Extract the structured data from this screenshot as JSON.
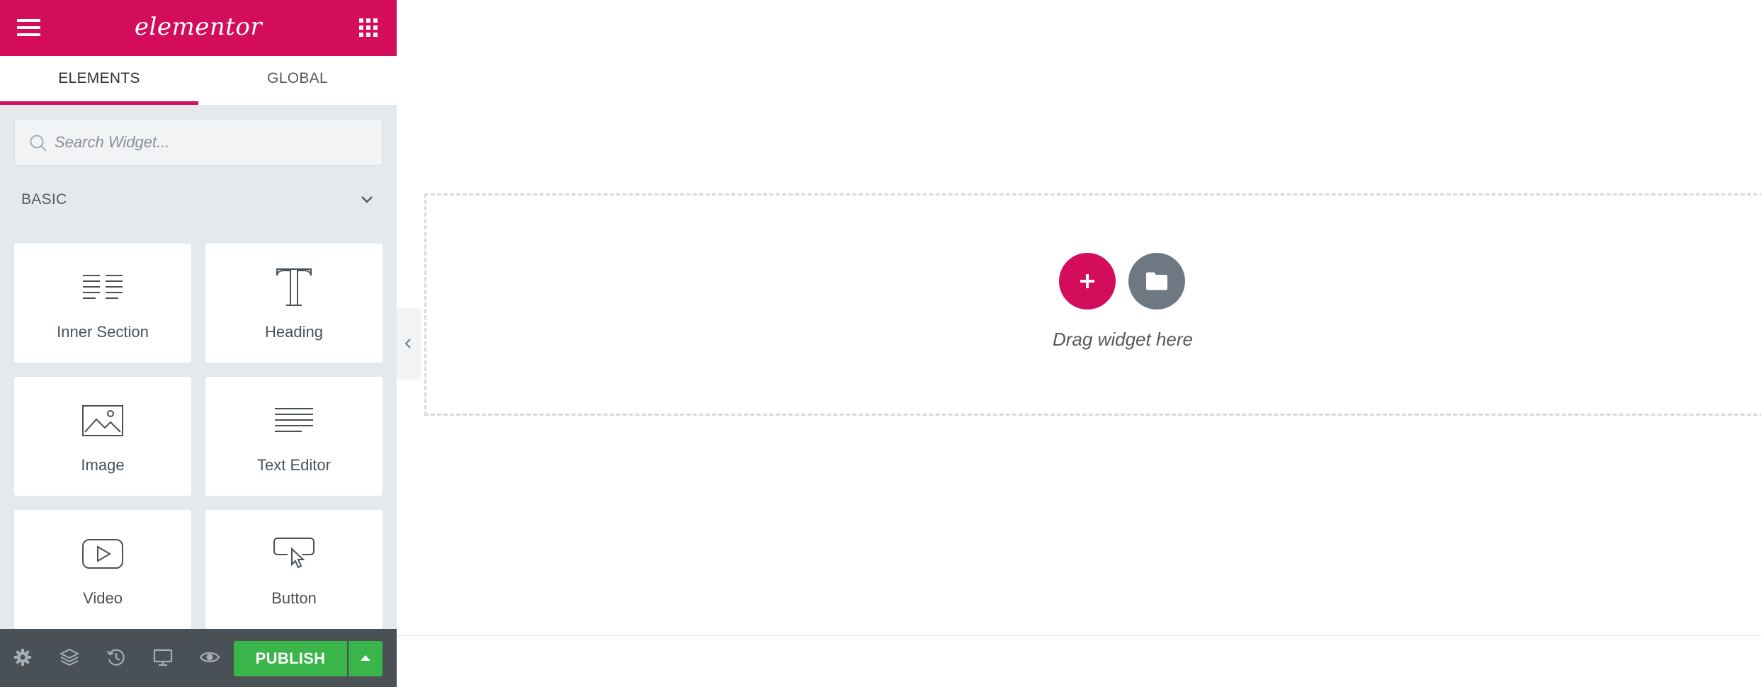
{
  "header": {
    "logo_text": "elementor",
    "brand_color": "#d30c5c",
    "menu_icon": "hamburger-icon",
    "apps_icon": "apps-grid-icon"
  },
  "tabs": [
    {
      "label": "ELEMENTS",
      "active": true
    },
    {
      "label": "GLOBAL",
      "active": false
    }
  ],
  "search": {
    "placeholder": "Search Widget...",
    "value": "",
    "icon": "search-icon"
  },
  "category": {
    "title": "BASIC",
    "icon": "chevron-down-icon"
  },
  "widgets": [
    {
      "label": "Inner Section",
      "icon": "inner-section-icon"
    },
    {
      "label": "Heading",
      "icon": "heading-icon"
    },
    {
      "label": "Image",
      "icon": "image-icon"
    },
    {
      "label": "Text Editor",
      "icon": "text-editor-icon"
    },
    {
      "label": "Video",
      "icon": "video-icon"
    },
    {
      "label": "Button",
      "icon": "button-icon"
    }
  ],
  "footer": {
    "icons": [
      "settings-icon",
      "navigator-icon",
      "history-icon",
      "responsive-icon",
      "preview-icon"
    ],
    "publish_label": "PUBLISH",
    "publish_color": "#39b54a"
  },
  "canvas": {
    "drag_text": "Drag widget here",
    "add_section_icon": "plus-icon",
    "add_template_icon": "folder-icon",
    "collapse_icon": "chevron-left-icon"
  }
}
